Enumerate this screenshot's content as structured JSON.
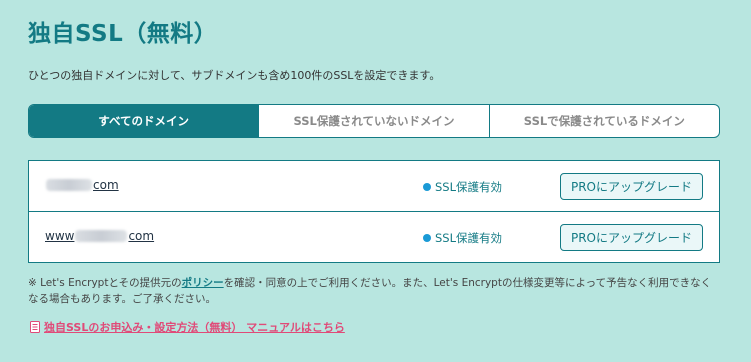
{
  "page": {
    "title": "独自SSL（無料）",
    "description": "ひとつの独自ドメインに対して、サブドメインも含め100件のSSLを設定できます。"
  },
  "tabs": [
    {
      "label": "すべてのドメイン",
      "active": true
    },
    {
      "label": "SSL保護されていないドメイン",
      "active": false
    },
    {
      "label": "SSLで保護されているドメイン",
      "active": false
    }
  ],
  "domains": [
    {
      "prefix": "",
      "suffix": "com",
      "status": "SSL保護有効",
      "action": "PROにアップグレード"
    },
    {
      "prefix": "www",
      "suffix": "com",
      "status": "SSL保護有効",
      "action": "PROにアップグレード"
    }
  ],
  "note": {
    "before": "※ Let's Encryptとその提供元の",
    "link": "ポリシー",
    "after": "を確認・同意の上でご利用ください。また、Let's Encryptの仕様変更等によって予告なく利用できなくなる場合もあります。ご了承ください。"
  },
  "manual": {
    "icon": "document-icon",
    "label": "独自SSLのお申込み・設定方法（無料） マニュアルはこちら"
  },
  "colors": {
    "background": "#b8e6e0",
    "accent": "#137a84",
    "status_dot": "#1a9ad6",
    "manual_link": "#e04a78"
  }
}
